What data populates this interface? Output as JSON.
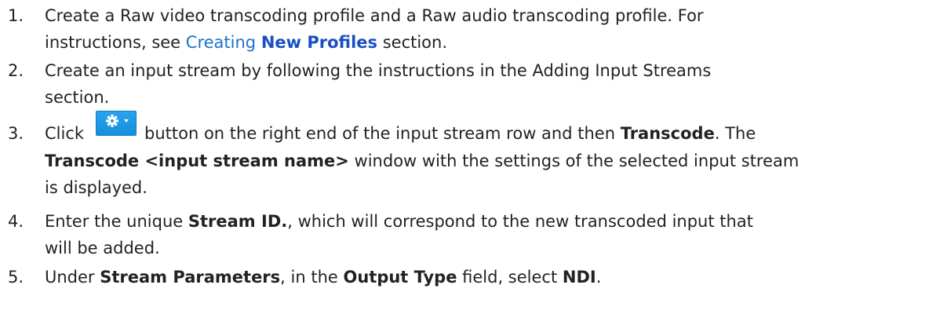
{
  "steps": [
    {
      "number": "1.",
      "line1_text": "Create a Raw video transcoding profile and a Raw audio transcoding profile. For",
      "line2_pre": "instructions, see ",
      "link_text": "Creating ",
      "link_bold": "New Profiles",
      "line2_post": " section."
    },
    {
      "number": "2.",
      "line1_text": "Create an input stream by following the instructions in the Adding Input Streams",
      "line2_text": "section."
    },
    {
      "number": "3.",
      "line1_pre": "Click",
      "line1_mid": "button on the right end of the input stream row and then ",
      "line1_bold": "Transcode",
      "line1_post": ". The",
      "line2_bold": "Transcode <input stream name>",
      "line2_post": " window with the settings of the selected input stream",
      "line3_text": "is displayed.",
      "button_icon": "gear-dropdown-icon",
      "button_color": "#1e9be6"
    },
    {
      "number": "4.",
      "line1_pre": "Enter the unique ",
      "line1_bold": "Stream ID.",
      "line1_post": ", which will correspond to the new transcoded input that",
      "line2_text": "will be added."
    },
    {
      "number": "5.",
      "line1_pre": "Under ",
      "line1_bold1": "Stream Parameters",
      "line1_mid": ", in the ",
      "line1_bold2": "Output Type",
      "line1_mid2": " field, select ",
      "line1_bold3": "NDI",
      "line1_post": "."
    }
  ]
}
